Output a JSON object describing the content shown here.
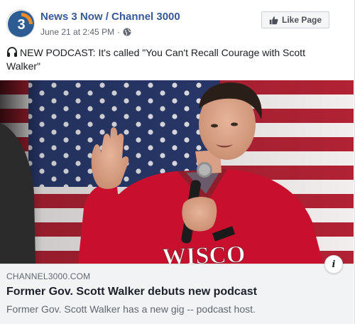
{
  "page": {
    "name": "News 3 Now / Channel 3000",
    "avatar_icon": "channel-3-logo",
    "timestamp": "June 21 at 2:45 PM",
    "separator": "·",
    "privacy_icon": "globe-icon"
  },
  "like_button": {
    "label": "Like Page",
    "icon": "thumbs-up-icon"
  },
  "post": {
    "message_icon": "headphones-icon",
    "message": "NEW PODCAST: It's called \"You Can't Recall Courage with Scott Walker\""
  },
  "photo": {
    "jacket_text": "WISCO"
  },
  "link_preview": {
    "domain": "CHANNEL3000.COM",
    "title": "Former Gov. Scott Walker debuts new podcast",
    "description": "Former Gov. Scott Walker has a new gig -- podcast host.",
    "info_label": "i"
  },
  "colors": {
    "page_name": "#385898",
    "meta_text": "#616770",
    "link_bg": "#f2f3f5",
    "logo_blue": "#2d5c93",
    "logo_orange": "#f08a24",
    "jacket_red": "#c8102e"
  }
}
